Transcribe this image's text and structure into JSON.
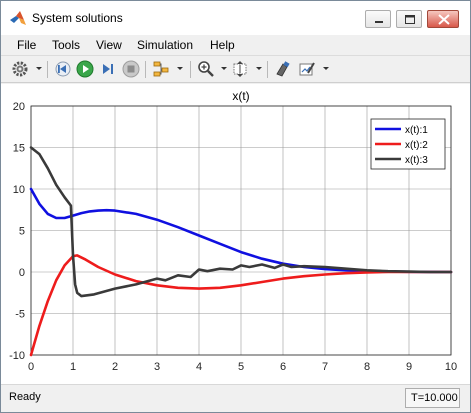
{
  "window": {
    "title": "System solutions",
    "min_icon": "minimize-icon",
    "max_icon": "maximize-icon",
    "close_icon": "close-icon"
  },
  "menu": [
    "File",
    "Tools",
    "View",
    "Simulation",
    "Help"
  ],
  "toolbar": {
    "icons": [
      "gear-icon",
      "step-back-icon",
      "run-icon",
      "step-forward-icon",
      "stop-icon",
      "signal-hierarchy-icon",
      "zoom-icon",
      "autoscale-icon",
      "highlight-icon",
      "style-icon"
    ]
  },
  "statusbar": {
    "left": "Ready",
    "right": "T=10.000"
  },
  "colors": {
    "series1": "#1010e0",
    "series2": "#ee1c1c",
    "series3": "#3a3a3a",
    "grid": "#9a9a9a"
  },
  "chart_data": {
    "type": "line",
    "title": "x(t)",
    "xlabel": "",
    "ylabel": "",
    "xlim": [
      0,
      10
    ],
    "ylim": [
      -10,
      20
    ],
    "xticks": [
      0,
      1,
      2,
      3,
      4,
      5,
      6,
      7,
      8,
      9,
      10
    ],
    "yticks": [
      -10,
      -5,
      0,
      5,
      10,
      15,
      20
    ],
    "grid": true,
    "legend": "top-right",
    "series": [
      {
        "name": "x(t):1",
        "x": [
          0,
          0.2,
          0.4,
          0.6,
          0.8,
          1.0,
          1.2,
          1.4,
          1.6,
          1.8,
          2.0,
          2.5,
          3.0,
          3.5,
          4.0,
          4.5,
          5.0,
          5.5,
          6.0,
          6.5,
          7.0,
          7.5,
          8.0,
          8.5,
          9.0,
          9.5,
          10.0
        ],
        "y": [
          10,
          8.2,
          7.0,
          6.5,
          6.5,
          6.8,
          7.1,
          7.3,
          7.4,
          7.45,
          7.4,
          7.0,
          6.3,
          5.4,
          4.4,
          3.4,
          2.4,
          1.6,
          1.0,
          0.6,
          0.35,
          0.2,
          0.1,
          0.05,
          0.02,
          0.01,
          0.0
        ]
      },
      {
        "name": "x(t):2",
        "x": [
          0,
          0.2,
          0.4,
          0.6,
          0.8,
          1.0,
          1.1,
          1.3,
          1.6,
          2.0,
          2.5,
          3.0,
          3.5,
          4.0,
          4.5,
          5.0,
          5.5,
          6.0,
          6.5,
          7.0,
          7.5,
          8.0,
          8.5,
          9.0,
          9.5,
          10.0
        ],
        "y": [
          -10,
          -6.5,
          -3.5,
          -1.0,
          0.8,
          1.9,
          2.0,
          1.5,
          0.6,
          -0.3,
          -1.1,
          -1.6,
          -1.9,
          -2.0,
          -1.9,
          -1.6,
          -1.2,
          -0.8,
          -0.5,
          -0.3,
          -0.15,
          -0.05,
          0.0,
          0.0,
          0.0,
          0.0
        ]
      },
      {
        "name": "x(t):3",
        "x": [
          0,
          0.2,
          0.4,
          0.6,
          0.8,
          0.95,
          1.0,
          1.05,
          1.1,
          1.2,
          1.5,
          2.0,
          2.5,
          3.0,
          3.2,
          3.5,
          3.8,
          4.0,
          4.2,
          4.5,
          4.8,
          5.0,
          5.2,
          5.5,
          5.8,
          6.0,
          6.2,
          6.5,
          7.0,
          7.5,
          8.0,
          8.5,
          9.0,
          9.5,
          10.0
        ],
        "y": [
          15,
          14.2,
          12.5,
          10.5,
          9.0,
          8.0,
          2.0,
          -1.5,
          -2.5,
          -2.9,
          -2.7,
          -2.0,
          -1.5,
          -0.8,
          -1.0,
          -0.4,
          -0.6,
          0.3,
          0.1,
          0.4,
          0.3,
          0.8,
          0.6,
          0.9,
          0.5,
          0.9,
          0.6,
          0.7,
          0.6,
          0.4,
          0.2,
          0.1,
          0.05,
          0.0,
          0.0
        ]
      }
    ]
  }
}
